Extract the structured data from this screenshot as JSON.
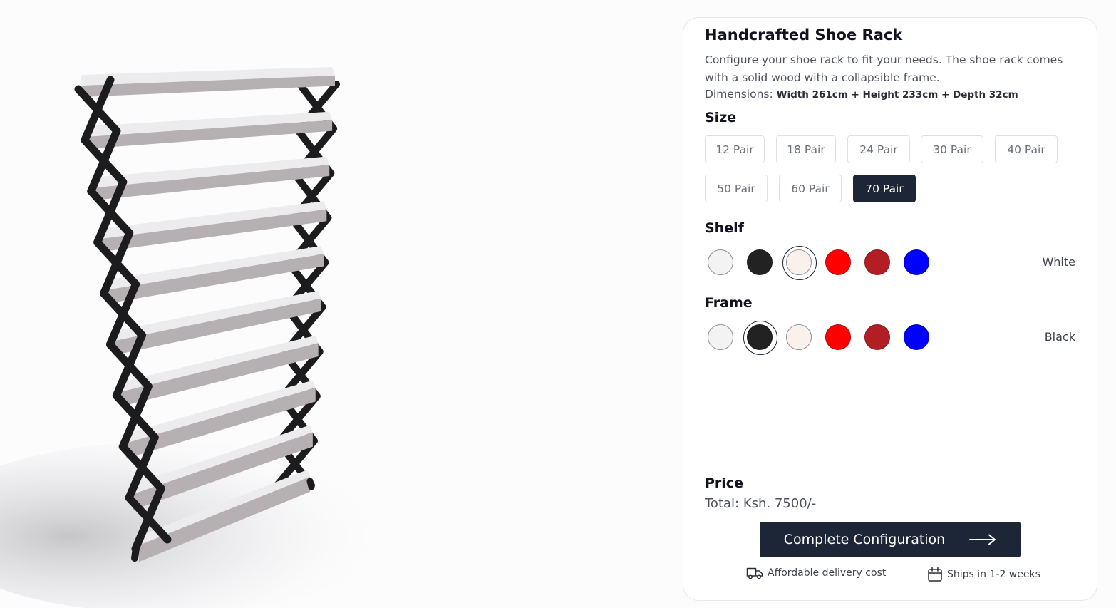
{
  "product": {
    "title": "Handcrafted Shoe Rack",
    "description": "Configure your shoe rack to fit your needs. The shoe rack comes with a solid wood with a collapsible frame.",
    "dimensions_label": "Dimensions:",
    "dimensions_value": "Width 261cm + Height 233cm + Depth 32cm"
  },
  "size": {
    "label": "Size",
    "options": [
      "12 Pair",
      "18 Pair",
      "24 Pair",
      "30 Pair",
      "40 Pair",
      "50 Pair",
      "60 Pair",
      "70 Pair"
    ],
    "selected": "70 Pair"
  },
  "shelf": {
    "label": "Shelf",
    "selected_name": "White",
    "swatches": [
      {
        "name": "white",
        "color": "#f3f3f4"
      },
      {
        "name": "black",
        "color": "#222222"
      },
      {
        "name": "cream",
        "color": "#fbf1ec"
      },
      {
        "name": "red",
        "color": "#ff0000"
      },
      {
        "name": "dark-red",
        "color": "#b31e24"
      },
      {
        "name": "blue",
        "color": "#0000ff"
      }
    ],
    "selected_index": 2
  },
  "frame": {
    "label": "Frame",
    "selected_name": "Black",
    "swatches": [
      {
        "name": "white",
        "color": "#f3f3f4"
      },
      {
        "name": "black",
        "color": "#222222"
      },
      {
        "name": "cream",
        "color": "#fbf1ec"
      },
      {
        "name": "red",
        "color": "#ff0000"
      },
      {
        "name": "dark-red",
        "color": "#b31e24"
      },
      {
        "name": "blue",
        "color": "#0000ff"
      }
    ],
    "selected_index": 1
  },
  "price": {
    "label": "Price",
    "total": "Total: Ksh. 7500/-"
  },
  "cta": {
    "label": "Complete Configuration",
    "icon": "arrow-right-icon"
  },
  "perks": [
    {
      "icon": "truck-icon",
      "text": "Affordable delivery cost"
    },
    {
      "icon": "calendar-icon",
      "text": "Ships in 1-2 weeks"
    }
  ],
  "colors": {
    "accent": "#1d2636",
    "frame": "#1c1c1e",
    "shelf_top": "#ececee",
    "shelf_edge": "#b6b0b3"
  }
}
